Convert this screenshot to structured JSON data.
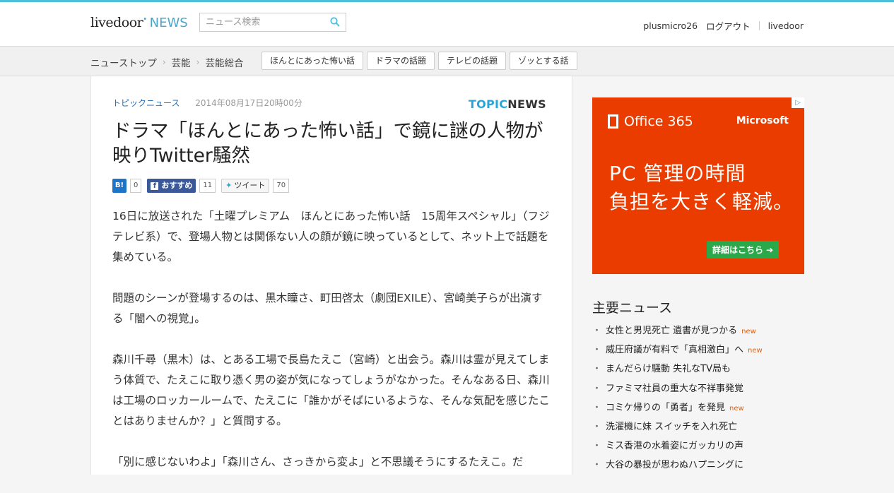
{
  "header": {
    "logo_brand": "livedoor",
    "logo_dot": "•",
    "logo_news": "NEWS",
    "search_placeholder": "ニュース検索",
    "username": "plusmicro26",
    "logout": "ログアウト",
    "livedoor_link": "livedoor"
  },
  "breadcrumb": {
    "items": [
      "ニューストップ",
      "芸能",
      "芸能総合"
    ],
    "tags": [
      "ほんとにあった怖い話",
      "ドラマの話題",
      "テレビの話題",
      "ゾッとする話"
    ]
  },
  "article": {
    "category": "トピックニュース",
    "date": "2014年08月17日20時00分",
    "source_logo_a": "TOPIC",
    "source_logo_b": "NEWS",
    "headline": "ドラマ「ほんとにあった怖い話」で鏡に謎の人物が映りTwitter騒然",
    "social": {
      "hatena_label": "B!",
      "hatena_count": "0",
      "fb_label": "おすすめ",
      "fb_count": "11",
      "tw_label": "ツイート",
      "tw_count": "70"
    },
    "paragraphs": [
      "16日に放送された「土曜プレミアム　ほんとにあった怖い話　15周年スペシャル」（フジテレビ系）で、登場人物とは関係ない人の顔が鏡に映っているとして、ネット上で話題を集めている。",
      "問題のシーンが登場するのは、黒木瞳さ、町田啓太（劇団EXILE）、宮崎美子らが出演する「闇への視覚」。",
      "森川千尋（黒木）は、とある工場で長島たえこ（宮崎）と出会う。森川は霊が見えてしまう体質で、たえこに取り憑く男の姿が気になってしょうがなかった。そんなある日、森川は工場のロッカールームで、たえこに「誰かがそばにいるような、そんな気配を感じたことはありませんか？」と質問する。",
      "「別に感じないわよ」「森川さん、さっきから変よ」と不思議そうにするたえこ。だ"
    ]
  },
  "ad": {
    "choices": "▷",
    "product": "Office 365",
    "brand": "Microsoft",
    "line1": "PC 管理の時間",
    "line2": "負担を大きく軽減。",
    "cta": "詳細はこちら ➔"
  },
  "sidebar": {
    "title": "主要ニュース",
    "new_label": "new",
    "items": [
      {
        "text": "女性と男児死亡 遺書が見つかる",
        "is_new": true
      },
      {
        "text": "威圧府議が有料で「真相激白」へ",
        "is_new": true
      },
      {
        "text": "まんだらけ騒動 失礼なTV局も",
        "is_new": false
      },
      {
        "text": "ファミマ社員の重大な不祥事発覚",
        "is_new": false
      },
      {
        "text": "コミケ帰りの「勇者」を発見",
        "is_new": true
      },
      {
        "text": "洗濯機に妹 スイッチを入れ死亡",
        "is_new": false
      },
      {
        "text": "ミス香港の水着姿にガッカリの声",
        "is_new": false
      },
      {
        "text": "大谷の暴投が思わぬハプニングに",
        "is_new": false
      }
    ]
  },
  "colors": {
    "accent": "#4ec0db",
    "ad_bg": "#eb3c00",
    "new_badge": "#e0600e"
  }
}
